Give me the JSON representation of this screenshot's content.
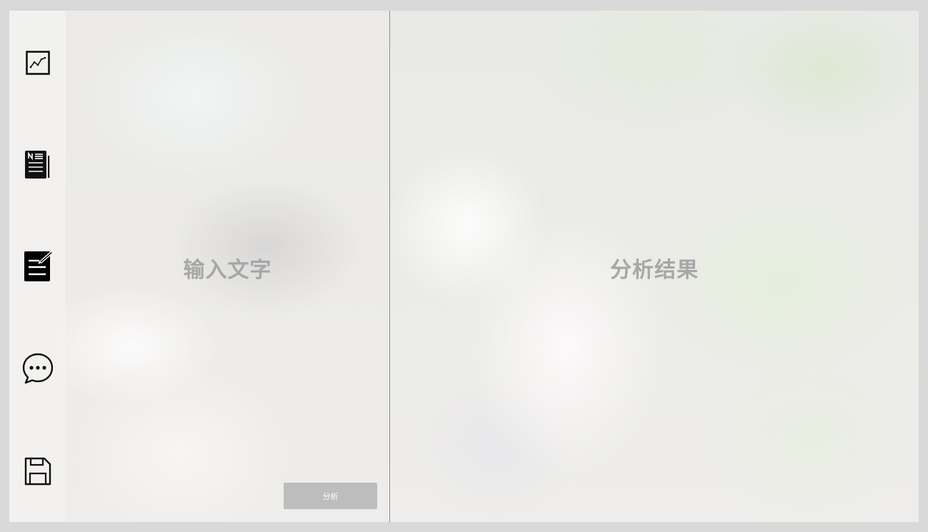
{
  "sidebar": {
    "items": [
      {
        "name": "chart",
        "icon": "line-chart-icon"
      },
      {
        "name": "news",
        "icon": "newspaper-icon"
      },
      {
        "name": "edit",
        "icon": "edit-document-icon",
        "active": true
      },
      {
        "name": "chat",
        "icon": "chat-bubble-icon"
      },
      {
        "name": "save",
        "icon": "save-disk-icon"
      }
    ]
  },
  "input_panel": {
    "placeholder": "输入文字",
    "analyze_button": "分析"
  },
  "result_panel": {
    "placeholder": "分析结果"
  },
  "colors": {
    "placeholder_text": "#a6a6a6",
    "button_bg": "#bdbdbd",
    "button_text": "#ffffff",
    "divider": "#8f8f8f",
    "page_frame": "#d9d9d9"
  }
}
